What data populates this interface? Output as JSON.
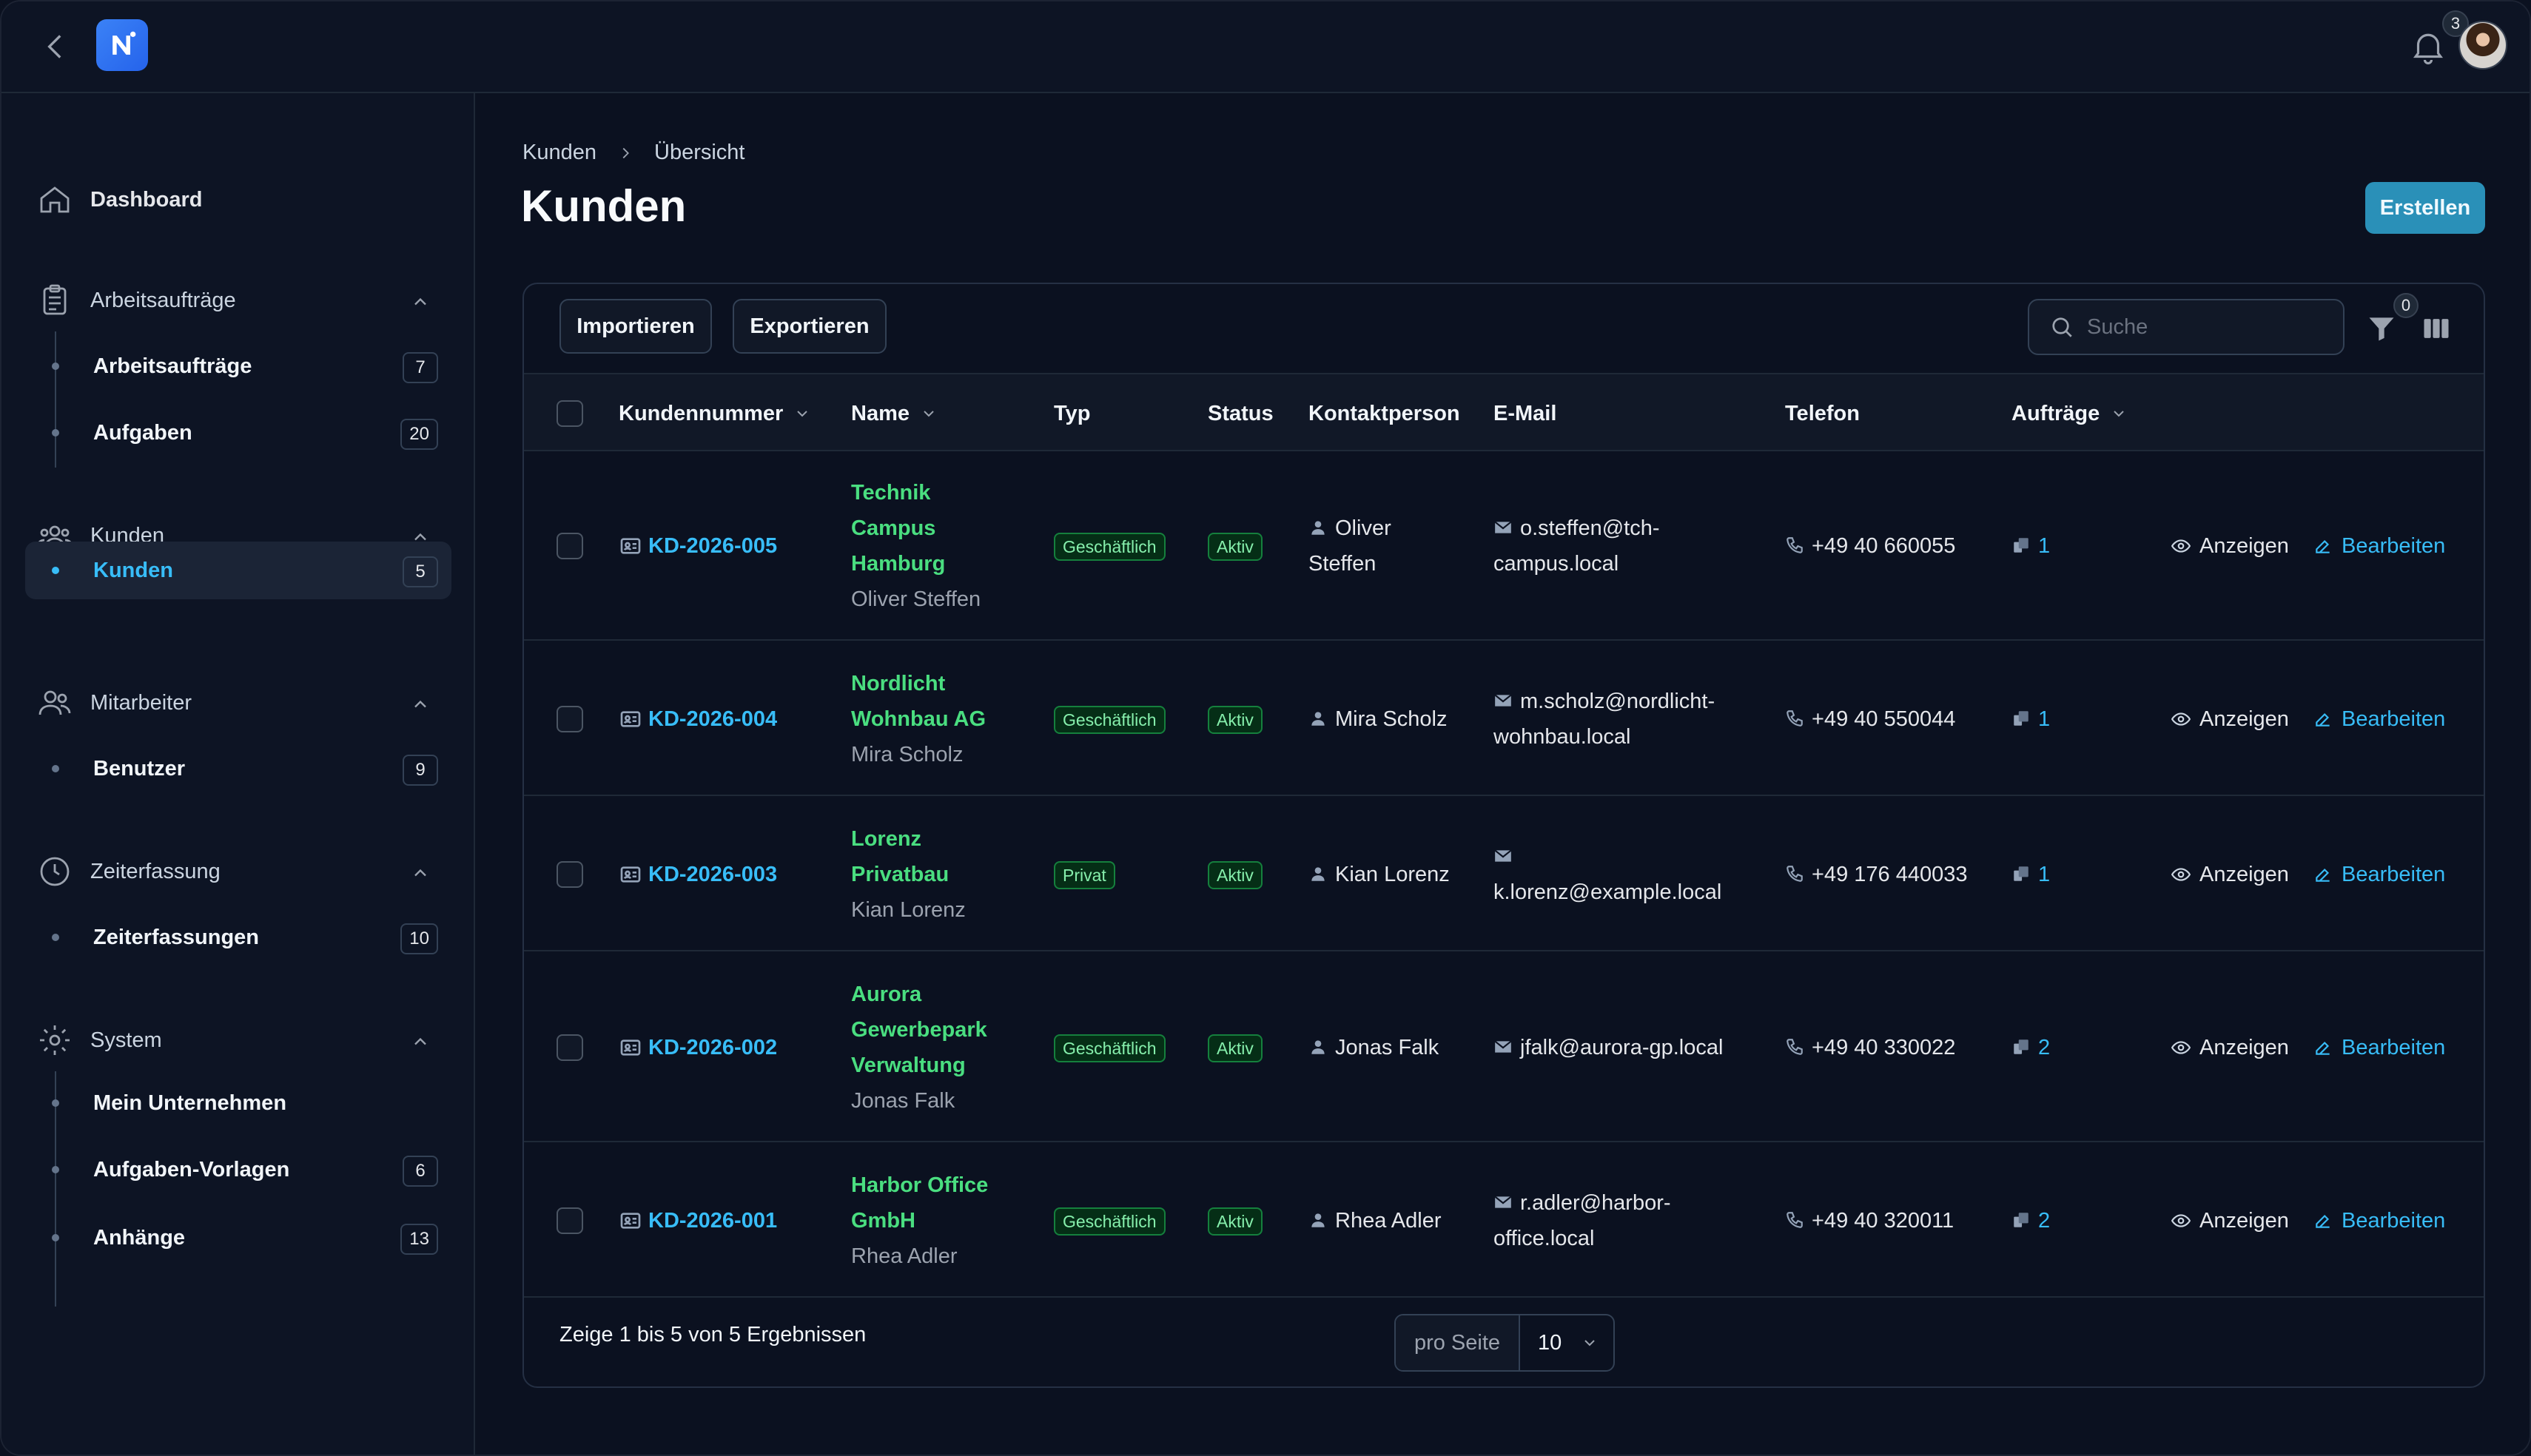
{
  "topbar": {
    "notification_count": "3"
  },
  "sidebar": {
    "dashboard": "Dashboard",
    "groups": [
      {
        "label": "Arbeitsaufträge",
        "items": [
          {
            "label": "Arbeitsaufträge",
            "count": "7"
          },
          {
            "label": "Aufgaben",
            "count": "20"
          }
        ]
      },
      {
        "label": "Kunden",
        "items": [
          {
            "label": "Kunden",
            "count": "5"
          }
        ]
      },
      {
        "label": "Mitarbeiter",
        "items": [
          {
            "label": "Benutzer",
            "count": "9"
          }
        ]
      },
      {
        "label": "Zeiterfassung",
        "items": [
          {
            "label": "Zeiterfassungen",
            "count": "10"
          }
        ]
      },
      {
        "label": "System",
        "items": [
          {
            "label": "Mein Unternehmen",
            "count": ""
          },
          {
            "label": "Aufgaben-Vorlagen",
            "count": "6"
          },
          {
            "label": "Anhänge",
            "count": "13"
          }
        ]
      }
    ]
  },
  "breadcrumb": {
    "parent": "Kunden",
    "current": "Übersicht"
  },
  "page": {
    "title": "Kunden",
    "create_label": "Erstellen"
  },
  "toolbar": {
    "import_label": "Importieren",
    "export_label": "Exportieren",
    "search_placeholder": "Suche",
    "filter_count": "0"
  },
  "table": {
    "headers": {
      "id": "Kundennummer",
      "name": "Name",
      "type": "Typ",
      "status": "Status",
      "contact": "Kontaktperson",
      "email": "E-Mail",
      "phone": "Telefon",
      "orders": "Aufträge"
    },
    "rows": [
      {
        "id": "KD-2026-005",
        "name_lines": [
          "Technik",
          "Campus",
          "Hamburg"
        ],
        "name_sub": "Oliver Steffen",
        "type": "Geschäftlich",
        "status": "Aktiv",
        "contact_lines": [
          "Oliver",
          "Steffen"
        ],
        "email_lines": [
          "o.steffen@tch-",
          "campus.local"
        ],
        "phone": "+49 40 660055",
        "orders": "1",
        "view": "Anzeigen",
        "edit": "Bearbeiten"
      },
      {
        "id": "KD-2026-004",
        "name_lines": [
          "Nordlicht",
          "Wohnbau AG"
        ],
        "name_sub": "Mira Scholz",
        "type": "Geschäftlich",
        "status": "Aktiv",
        "contact_lines": [
          "Mira Scholz"
        ],
        "email_lines": [
          "m.scholz@nordlicht-",
          "wohnbau.local"
        ],
        "phone": "+49 40 550044",
        "orders": "1",
        "view": "Anzeigen",
        "edit": "Bearbeiten"
      },
      {
        "id": "KD-2026-003",
        "name_lines": [
          "Lorenz",
          "Privatbau"
        ],
        "name_sub": "Kian Lorenz",
        "type": "Privat",
        "status": "Aktiv",
        "contact_lines": [
          "Kian Lorenz"
        ],
        "email_lines": [
          "",
          "k.lorenz@example.local"
        ],
        "phone": "+49 176 440033",
        "orders": "1",
        "view": "Anzeigen",
        "edit": "Bearbeiten"
      },
      {
        "id": "KD-2026-002",
        "name_lines": [
          "Aurora",
          "Gewerbepark",
          "Verwaltung"
        ],
        "name_sub": "Jonas Falk",
        "type": "Geschäftlich",
        "status": "Aktiv",
        "contact_lines": [
          "Jonas Falk"
        ],
        "email_lines": [
          "jfalk@aurora-gp.local"
        ],
        "phone": "+49 40 330022",
        "orders": "2",
        "view": "Anzeigen",
        "edit": "Bearbeiten"
      },
      {
        "id": "KD-2026-001",
        "name_lines": [
          "Harbor Office",
          "GmbH"
        ],
        "name_sub": "Rhea Adler",
        "type": "Geschäftlich",
        "status": "Aktiv",
        "contact_lines": [
          "Rhea Adler"
        ],
        "email_lines": [
          "r.adler@harbor-",
          "office.local"
        ],
        "phone": "+49 40 320011",
        "orders": "2",
        "view": "Anzeigen",
        "edit": "Bearbeiten"
      }
    ]
  },
  "footer": {
    "summary": "Zeige 1 bis 5 von 5 Ergebnissen",
    "per_page_label": "pro Seite",
    "per_page_value": "10"
  },
  "colors": {
    "accent": "#38bdf8",
    "primary_button": "#2a90b8",
    "name_green": "#4ade80",
    "badge_green": "#86efac"
  }
}
